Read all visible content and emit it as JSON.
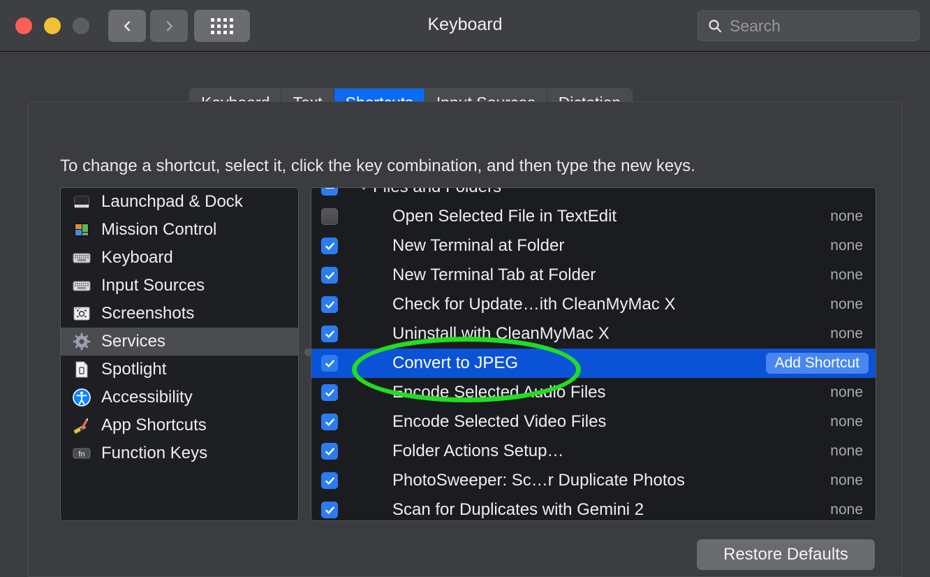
{
  "window": {
    "title": "Keyboard",
    "traffic_lights": [
      "close",
      "minimize",
      "zoom"
    ],
    "nav": {
      "back_icon": "chevron-left-icon",
      "forward_icon": "chevron-right-icon",
      "grid_icon": "grid-dots-icon"
    }
  },
  "search": {
    "placeholder": "Search",
    "icon": "search-icon"
  },
  "tabs": [
    {
      "label": "Keyboard",
      "active": false
    },
    {
      "label": "Text",
      "active": false
    },
    {
      "label": "Shortcuts",
      "active": true
    },
    {
      "label": "Input Sources",
      "active": false
    },
    {
      "label": "Dictation",
      "active": false
    }
  ],
  "hint": "To change a shortcut, select it, click the key combination, and then type the new keys.",
  "sidebar": {
    "items": [
      {
        "label": "Launchpad & Dock",
        "icon": "launchpad-dock-icon",
        "selected": false
      },
      {
        "label": "Mission Control",
        "icon": "mission-control-icon",
        "selected": false
      },
      {
        "label": "Keyboard",
        "icon": "keyboard-icon",
        "selected": false
      },
      {
        "label": "Input Sources",
        "icon": "input-sources-icon",
        "selected": false
      },
      {
        "label": "Screenshots",
        "icon": "screenshots-icon",
        "selected": false
      },
      {
        "label": "Services",
        "icon": "services-gear-icon",
        "selected": true
      },
      {
        "label": "Spotlight",
        "icon": "spotlight-document-icon",
        "selected": false
      },
      {
        "label": "Accessibility",
        "icon": "accessibility-icon",
        "selected": false
      },
      {
        "label": "App Shortcuts",
        "icon": "app-shortcuts-icon",
        "selected": false
      },
      {
        "label": "Function Keys",
        "icon": "function-keys-fn-icon",
        "selected": false
      }
    ]
  },
  "shortcuts": {
    "group": {
      "label": "Files and Folders",
      "checkbox": "mixed",
      "expanded": true
    },
    "rows": [
      {
        "label": "Open Selected File in TextEdit",
        "checkbox": "off",
        "key": "none",
        "selected": false
      },
      {
        "label": "New Terminal at Folder",
        "checkbox": "on",
        "key": "none",
        "selected": false
      },
      {
        "label": "New Terminal Tab at Folder",
        "checkbox": "on",
        "key": "none",
        "selected": false
      },
      {
        "label": "Check for Update…ith CleanMyMac X",
        "checkbox": "on",
        "key": "none",
        "selected": false
      },
      {
        "label": "Uninstall with CleanMyMac X",
        "checkbox": "on",
        "key": "none",
        "selected": false
      },
      {
        "label": "Convert to JPEG",
        "checkbox": "on",
        "key": "Add Shortcut",
        "selected": true
      },
      {
        "label": "Encode Selected Audio Files",
        "checkbox": "on",
        "key": "none",
        "selected": false
      },
      {
        "label": "Encode Selected Video Files",
        "checkbox": "on",
        "key": "none",
        "selected": false
      },
      {
        "label": "Folder Actions Setup…",
        "checkbox": "on",
        "key": "none",
        "selected": false
      },
      {
        "label": "PhotoSweeper: Sc…r Duplicate Photos",
        "checkbox": "on",
        "key": "none",
        "selected": false
      },
      {
        "label": "Scan for Duplicates with Gemini 2",
        "checkbox": "on",
        "key": "none",
        "selected": false
      }
    ]
  },
  "restore_button": {
    "label": "Restore Defaults"
  },
  "annotation": {
    "shape": "ellipse",
    "color": "#22dd22",
    "target": "Convert to JPEG"
  },
  "colors": {
    "accent_blue": "#0a6cf5",
    "selection_blue": "#0a52d6",
    "checkbox_blue": "#2b7cf0",
    "window_bg": "#3b3c3f",
    "list_bg": "#1b1c1f",
    "annotation_green": "#22dd22"
  }
}
